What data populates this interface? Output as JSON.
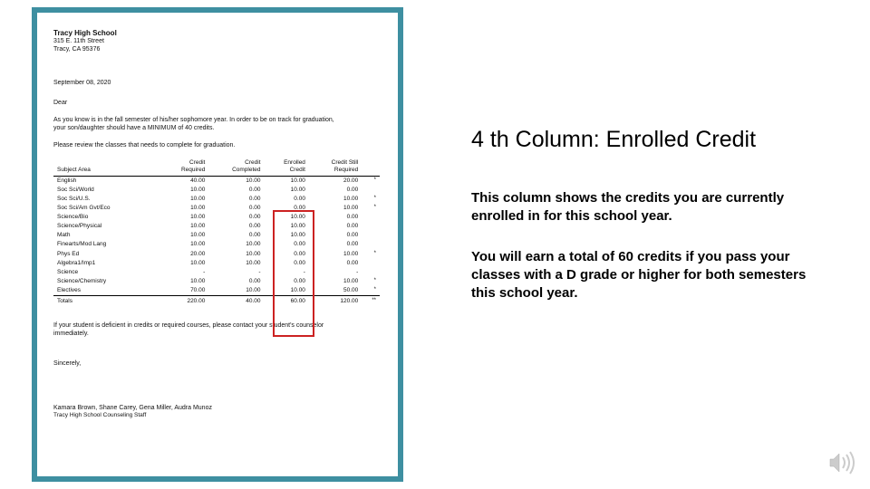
{
  "letter": {
    "school_name": "Tracy High School",
    "address_line1": "315 E. 11th Street",
    "address_line2": "Tracy, CA 95376",
    "date": "September 08, 2020",
    "greeting": "Dear",
    "body_line1": "As you know       is in the fall semester of his/her sophomore year.  In order to be on track for graduation,",
    "body_line2": "your son/daughter should have a MINIMUM of 40 credits.",
    "review_line": "Please review the classes that         needs to complete for graduation.",
    "footer_line1": "If your student is deficient in credits or required courses, please contact your student's counselor",
    "footer_line2": "immediately.",
    "sincerely": "Sincerely,",
    "signers": "Kamara Brown, Shane Carey, Gena Miller, Audra Munoz",
    "sig_title": "Tracy High School Counseling Staff"
  },
  "table": {
    "headers": {
      "subject": "Subject Area",
      "required": "Credit\nRequired",
      "completed": "Credit\nCompleted",
      "enrolled": "Enrolled\nCredit",
      "still": "Credit Still\nRequired"
    },
    "rows": [
      {
        "subject": "English",
        "required": "40.00",
        "completed": "10.00",
        "enrolled": "10.00",
        "still": "20.00",
        "star": "*"
      },
      {
        "subject": "Soc Sci/World",
        "required": "10.00",
        "completed": "0.00",
        "enrolled": "10.00",
        "still": "0.00",
        "star": ""
      },
      {
        "subject": "Soc Sci/U.S.",
        "required": "10.00",
        "completed": "0.00",
        "enrolled": "0.00",
        "still": "10.00",
        "star": "*"
      },
      {
        "subject": "Soc Sci/Am Gvt/Eco",
        "required": "10.00",
        "completed": "0.00",
        "enrolled": "0.00",
        "still": "10.00",
        "star": "*"
      },
      {
        "subject": "Science/Bio",
        "required": "10.00",
        "completed": "0.00",
        "enrolled": "10.00",
        "still": "0.00",
        "star": ""
      },
      {
        "subject": "Science/Physical",
        "required": "10.00",
        "completed": "0.00",
        "enrolled": "10.00",
        "still": "0.00",
        "star": ""
      },
      {
        "subject": "Math",
        "required": "10.00",
        "completed": "0.00",
        "enrolled": "10.00",
        "still": "0.00",
        "star": ""
      },
      {
        "subject": "Finearts/Mod Lang",
        "required": "10.00",
        "completed": "10.00",
        "enrolled": "0.00",
        "still": "0.00",
        "star": ""
      },
      {
        "subject": "Phys Ed",
        "required": "20.00",
        "completed": "10.00",
        "enrolled": "0.00",
        "still": "10.00",
        "star": "*"
      },
      {
        "subject": "Algebra1/Imp1",
        "required": "10.00",
        "completed": "10.00",
        "enrolled": "0.00",
        "still": "0.00",
        "star": ""
      },
      {
        "subject": "Science",
        "required": "-",
        "completed": "-",
        "enrolled": "-",
        "still": "-",
        "star": ""
      },
      {
        "subject": "Science/Chemistry",
        "required": "10.00",
        "completed": "0.00",
        "enrolled": "0.00",
        "still": "10.00",
        "star": "*"
      },
      {
        "subject": "Electives",
        "required": "70.00",
        "completed": "10.00",
        "enrolled": "10.00",
        "still": "50.00",
        "star": "*"
      }
    ],
    "totals": {
      "label": "Totals",
      "required": "220.00",
      "completed": "40.00",
      "enrolled": "60.00",
      "still": "120.00",
      "star": "**"
    }
  },
  "right": {
    "heading": "4 th Column: Enrolled Credit",
    "p1": "This column shows the credits you are currently enrolled in for this school year.",
    "p2": "You will earn a total of 60 credits if you pass your classes with a D grade or higher for both semesters this school year."
  }
}
